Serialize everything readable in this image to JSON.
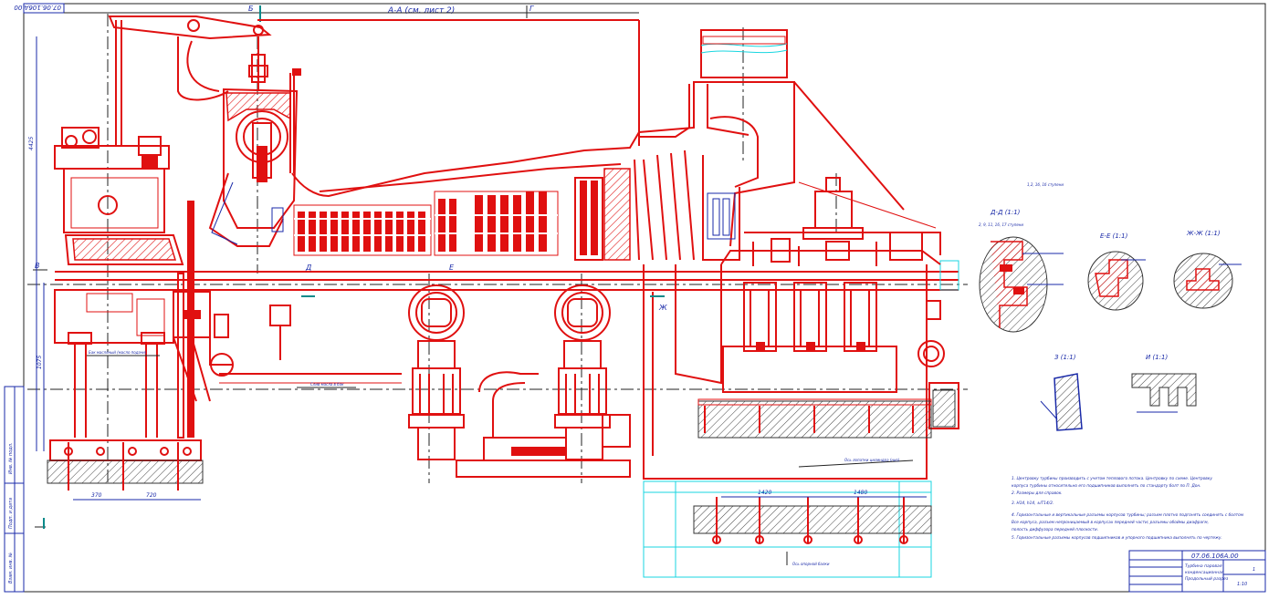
{
  "drawing": {
    "doc_code_top": "07.06.106А.00",
    "section_title": "А-А (см. лист 2)",
    "mark_b": "Б",
    "mark_g": "Г",
    "mark_v": "В",
    "mark_d": "Д",
    "mark_e": "Е",
    "mark_zh": "Ж",
    "section_dd": "Д-Д (1:1)",
    "section_dd_note": "2, 9, 11, 16, 17 ступени",
    "section_ee": "Е-Е (1:1)",
    "section_zhzh": "Ж-Ж (1:1)",
    "view_z": "З (1:1)",
    "view_i": "И (1:1)",
    "small_note": "1,2, 1б, 1б ступени",
    "label_oil": "Бак масляный (масло подачи)",
    "label_line": "Слив масла в бак",
    "label_foundation": "Ось лопатки цилиндра (низ)",
    "label_pipe": "Ось опорной балки",
    "dims": {
      "d1": "370",
      "d2": "720",
      "d3": "1420",
      "d4": "1480",
      "d5": "4425",
      "d6": "1075"
    },
    "notes": [
      "1. Центровку турбины производить с учетом теплового потока. Центровку по схеме. Центровку",
      "корпуса турбины относительно его подшипников выполнять по стандарту болт по П. Дон.",
      "2. Размеры для справок.",
      "3. Н14, h14, ±IT14/2.",
      "4. Горизонтальные и вертикальные разъемы корпусов турбины; разъем плотно подгонять соединять с болтом",
      "Все корпуса, разъем непроницаемый в корпусах передней части; разъемы обоймы диафрагм,",
      "полость диффузора передней плоскости.",
      "5. Горизонтальные разъемы корпусов подшипников и упорного подшипника выполнять по чертежу."
    ],
    "title_block": {
      "doc_code": "07.06.106А.00",
      "name_line1": "Турбина паровая",
      "name_line2": "конденсационная",
      "name_line3": "Продольный разрез",
      "sheet": "1",
      "scale": "1:10"
    },
    "left_strip": {
      "item1": "Инв. № подл.",
      "item2": "Подп. и дата",
      "item3": "Взам. инв. №"
    },
    "colors": {
      "main": "#e01010",
      "dims": "#1a2aa8",
      "foundation": "#19d6e0",
      "axis": "#222222"
    }
  }
}
